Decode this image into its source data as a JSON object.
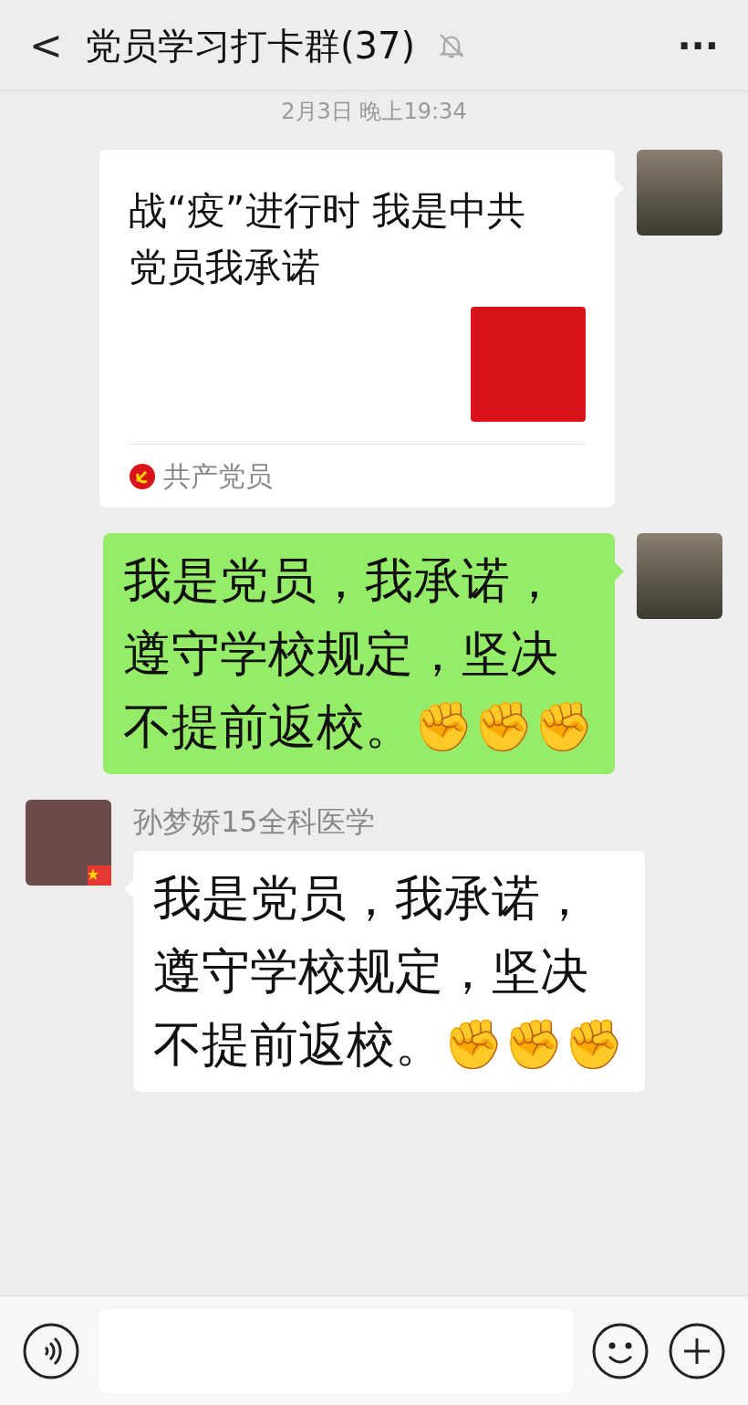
{
  "header": {
    "back": "<",
    "title": "党员学习打卡群(37)",
    "muted": true,
    "more": "···"
  },
  "timestamp": "2月3日 晚上19:34",
  "messages": [
    {
      "kind": "card",
      "title": "战“疫”进行时 我是中共党员我承诺",
      "source": "共产党员"
    },
    {
      "kind": "sent",
      "text": "我是党员，我承诺，遵守学校规定，坚决不提前返校。✊✊✊"
    },
    {
      "kind": "received",
      "sender": "孙梦娇15全科医学",
      "text": "我是党员，我承诺，遵守学校规定，坚决不提前返校。✊✊✊"
    }
  ]
}
